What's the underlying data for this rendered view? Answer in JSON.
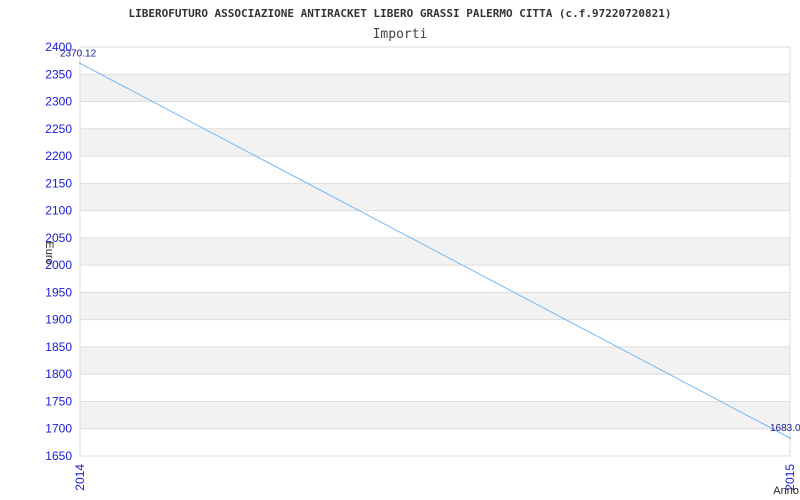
{
  "chart_data": {
    "type": "line",
    "title": "LIBEROFUTURO ASSOCIAZIONE ANTIRACKET LIBERO GRASSI PALERMO CITTA (c.f.97220720821)",
    "subtitle": "Importi",
    "xlabel": "Anno",
    "ylabel": "Euro",
    "categories": [
      "2014",
      "2015"
    ],
    "series": [
      {
        "values": [
          2370.12,
          1683.0
        ]
      }
    ],
    "data_labels": [
      "2370.12",
      "1683.0"
    ],
    "ylim": [
      1650,
      2400
    ],
    "yticks": [
      1650,
      1700,
      1750,
      1800,
      1850,
      1900,
      1950,
      2000,
      2050,
      2100,
      2150,
      2200,
      2250,
      2300,
      2350,
      2400
    ],
    "grid": true,
    "colors": {
      "line": "#7ab8ee",
      "tick": "#1a1ad6",
      "band": "#f2f2f2",
      "grid": "#dddddd"
    }
  }
}
